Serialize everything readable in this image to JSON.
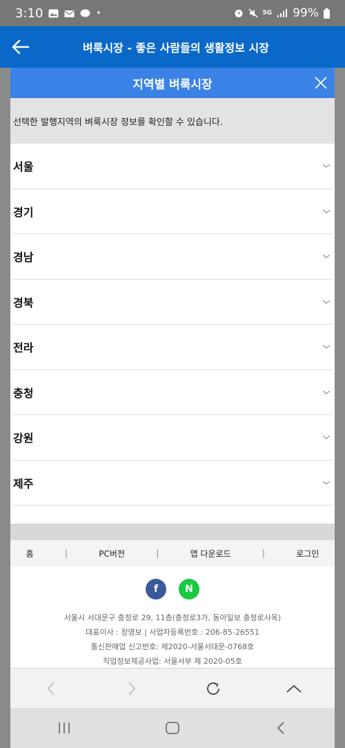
{
  "status_bar": {
    "time": "3:10",
    "battery": "99%",
    "network": "5G"
  },
  "app_header": {
    "title": "벼룩시장 - 좋은 사람들의 생활정보 시장"
  },
  "modal": {
    "title": "지역별 벼룩시장",
    "description": "선택한 발행지역의 벼룩시장 정보를 확인할 수 있습니다.",
    "regions": [
      "서울",
      "경기",
      "경남",
      "경북",
      "전라",
      "충청",
      "강원",
      "제주"
    ]
  },
  "footer_nav": {
    "home": "홈",
    "pc_version": "PC버전",
    "app_download": "앱 다운로드",
    "login": "로그인"
  },
  "social": {
    "facebook": "f",
    "naver": "N"
  },
  "company_info": {
    "address": "서울시 서대문구 충정로 29, 11층(충정로3가, 동아일보 충정로사옥)",
    "ceo_reg": "대표이사 : 장영보 | 사업자등록번호 : 206-85-26551",
    "telecom_sales": "통신판매업 신고번호: 제2020-서울서대문-0768호",
    "job_info": "직업정보제공사업: 서울서부 제 2020-05호"
  },
  "colors": {
    "app_header": "#0a68c9",
    "modal_header": "#3b82e6",
    "facebook": "#3b5a9c",
    "naver": "#19c93f"
  }
}
